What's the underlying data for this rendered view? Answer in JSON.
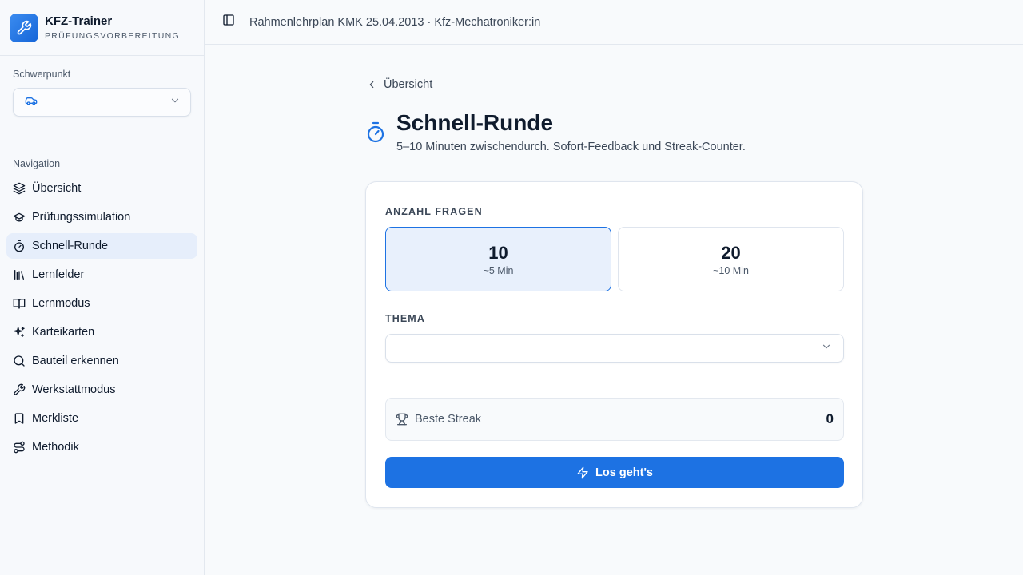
{
  "brand": {
    "title": "KFZ-Trainer",
    "subtitle": "PRÜFUNGSVORBEREITUNG",
    "icon": "wrench-icon"
  },
  "sidebar": {
    "focus_label": "Schwerpunkt",
    "focus_value_icon": "car-icon",
    "nav_label": "Navigation",
    "items": [
      {
        "label": "Übersicht",
        "icon": "layers-icon",
        "active": false
      },
      {
        "label": "Prüfungssimulation",
        "icon": "graduation-cap-icon",
        "active": false
      },
      {
        "label": "Schnell-Runde",
        "icon": "timer-icon",
        "active": true
      },
      {
        "label": "Lernfelder",
        "icon": "library-icon",
        "active": false
      },
      {
        "label": "Lernmodus",
        "icon": "book-open-icon",
        "active": false
      },
      {
        "label": "Karteikarten",
        "icon": "sparkles-icon",
        "active": false
      },
      {
        "label": "Bauteil erkennen",
        "icon": "search-icon",
        "active": false
      },
      {
        "label": "Werkstattmodus",
        "icon": "wrench-icon",
        "active": false
      },
      {
        "label": "Merkliste",
        "icon": "bookmark-icon",
        "active": false
      },
      {
        "label": "Methodik",
        "icon": "route-icon",
        "active": false
      }
    ]
  },
  "topbar": {
    "text": "Rahmenlehrplan KMK 25.04.2013 · Kfz-Mechatroniker:in",
    "toggle_icon": "sidebar-toggle-icon"
  },
  "main": {
    "back_label": "Übersicht",
    "title": "Schnell-Runde",
    "subtitle": "5–10 Minuten zwischendurch. Sofort-Feedback und Streak-Counter.",
    "count_label": "ANZAHL FRAGEN",
    "options": [
      {
        "count": "10",
        "time": "~5 Min",
        "selected": true
      },
      {
        "count": "20",
        "time": "~10 Min",
        "selected": false
      }
    ],
    "topic_label": "THEMA",
    "topic_value": "",
    "streak_label": "Beste Streak",
    "streak_value": "0",
    "start_label": "Los geht's"
  },
  "colors": {
    "accent": "#1d72e3",
    "active_bg": "#e6eefb",
    "text": "#0f1b2d",
    "muted": "#4b5869"
  }
}
